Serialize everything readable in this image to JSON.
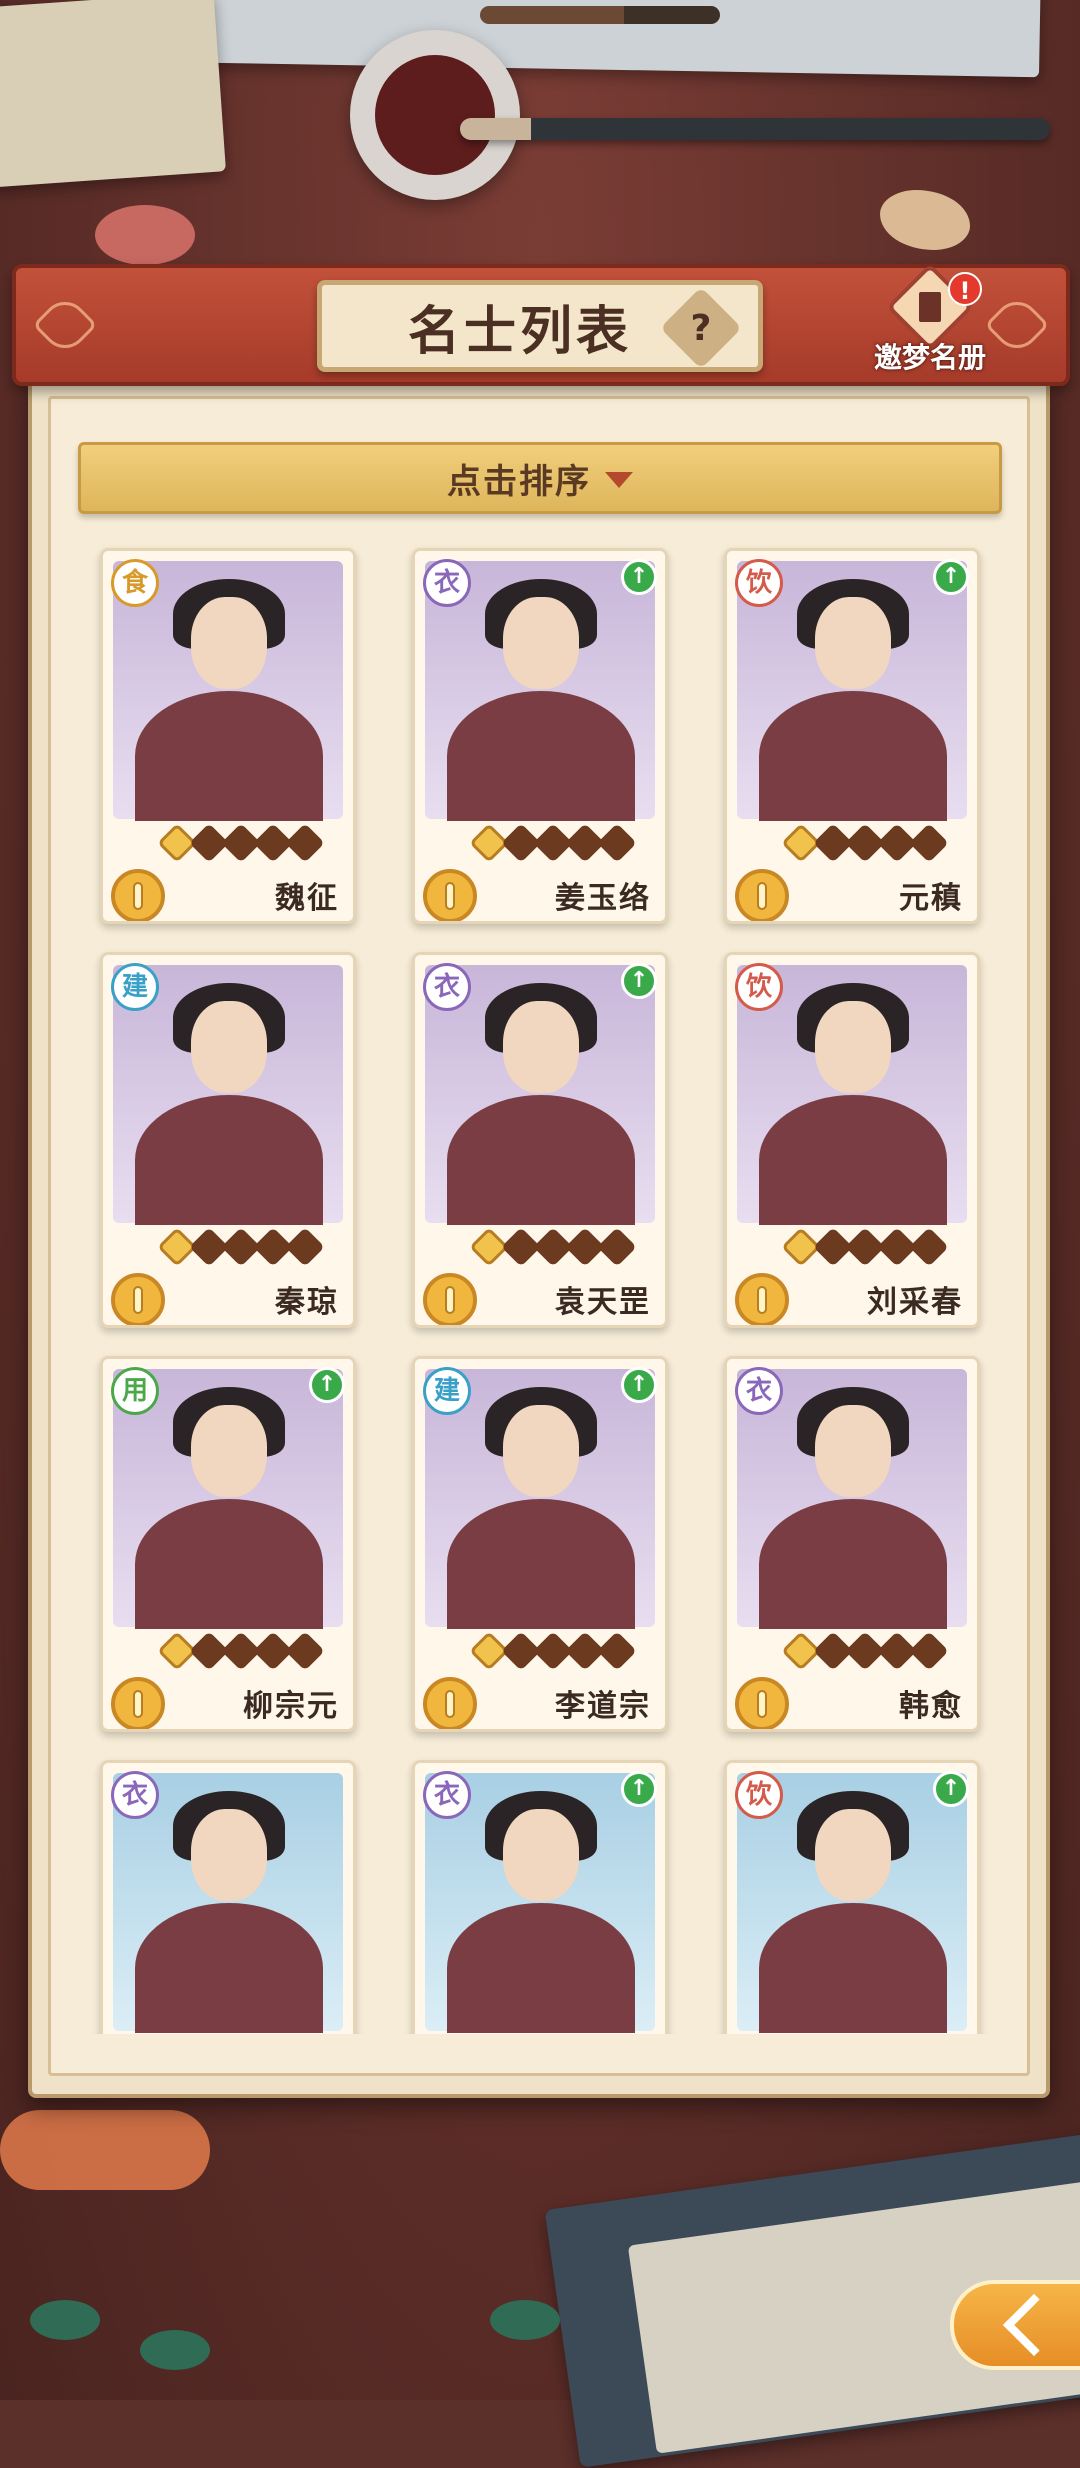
{
  "header": {
    "title": "名士列表",
    "help_label": "?",
    "book_button_label": "邀梦名册",
    "notification_badge": "!"
  },
  "sort_bar": {
    "label": "点击排序"
  },
  "cards": [
    {
      "name": "魏征",
      "type": "食",
      "type_color": "#d79a2b",
      "upgrade": false,
      "stars_filled": 1,
      "portrait": "purple"
    },
    {
      "name": "姜玉络",
      "type": "衣",
      "type_color": "#8a67b9",
      "upgrade": true,
      "stars_filled": 1,
      "portrait": "purple"
    },
    {
      "name": "元稹",
      "type": "饮",
      "type_color": "#d45a4a",
      "upgrade": true,
      "stars_filled": 1,
      "portrait": "purple"
    },
    {
      "name": "秦琼",
      "type": "建",
      "type_color": "#3aa0c8",
      "upgrade": false,
      "stars_filled": 1,
      "portrait": "purple"
    },
    {
      "name": "袁天罡",
      "type": "衣",
      "type_color": "#8a67b9",
      "upgrade": true,
      "stars_filled": 1,
      "portrait": "purple"
    },
    {
      "name": "刘采春",
      "type": "饮",
      "type_color": "#d45a4a",
      "upgrade": false,
      "stars_filled": 1,
      "portrait": "purple"
    },
    {
      "name": "柳宗元",
      "type": "用",
      "type_color": "#4aa84a",
      "upgrade": true,
      "stars_filled": 1,
      "portrait": "purple"
    },
    {
      "name": "李道宗",
      "type": "建",
      "type_color": "#3aa0c8",
      "upgrade": true,
      "stars_filled": 1,
      "portrait": "purple"
    },
    {
      "name": "韩愈",
      "type": "衣",
      "type_color": "#8a67b9",
      "upgrade": false,
      "stars_filled": 1,
      "portrait": "purple"
    },
    {
      "name": "",
      "type": "衣",
      "type_color": "#8a67b9",
      "upgrade": false,
      "stars_filled": 1,
      "portrait": "blue"
    },
    {
      "name": "",
      "type": "衣",
      "type_color": "#8a67b9",
      "upgrade": true,
      "stars_filled": 1,
      "portrait": "blue"
    },
    {
      "name": "",
      "type": "饮",
      "type_color": "#d45a4a",
      "upgrade": true,
      "stars_filled": 1,
      "portrait": "blue"
    }
  ],
  "icons": {
    "help": "question-icon",
    "book": "book-icon",
    "sort": "triangle-down-icon",
    "upgrade": "arrow-up-icon",
    "coin": "coin-icon",
    "back": "back-arrow-icon"
  }
}
